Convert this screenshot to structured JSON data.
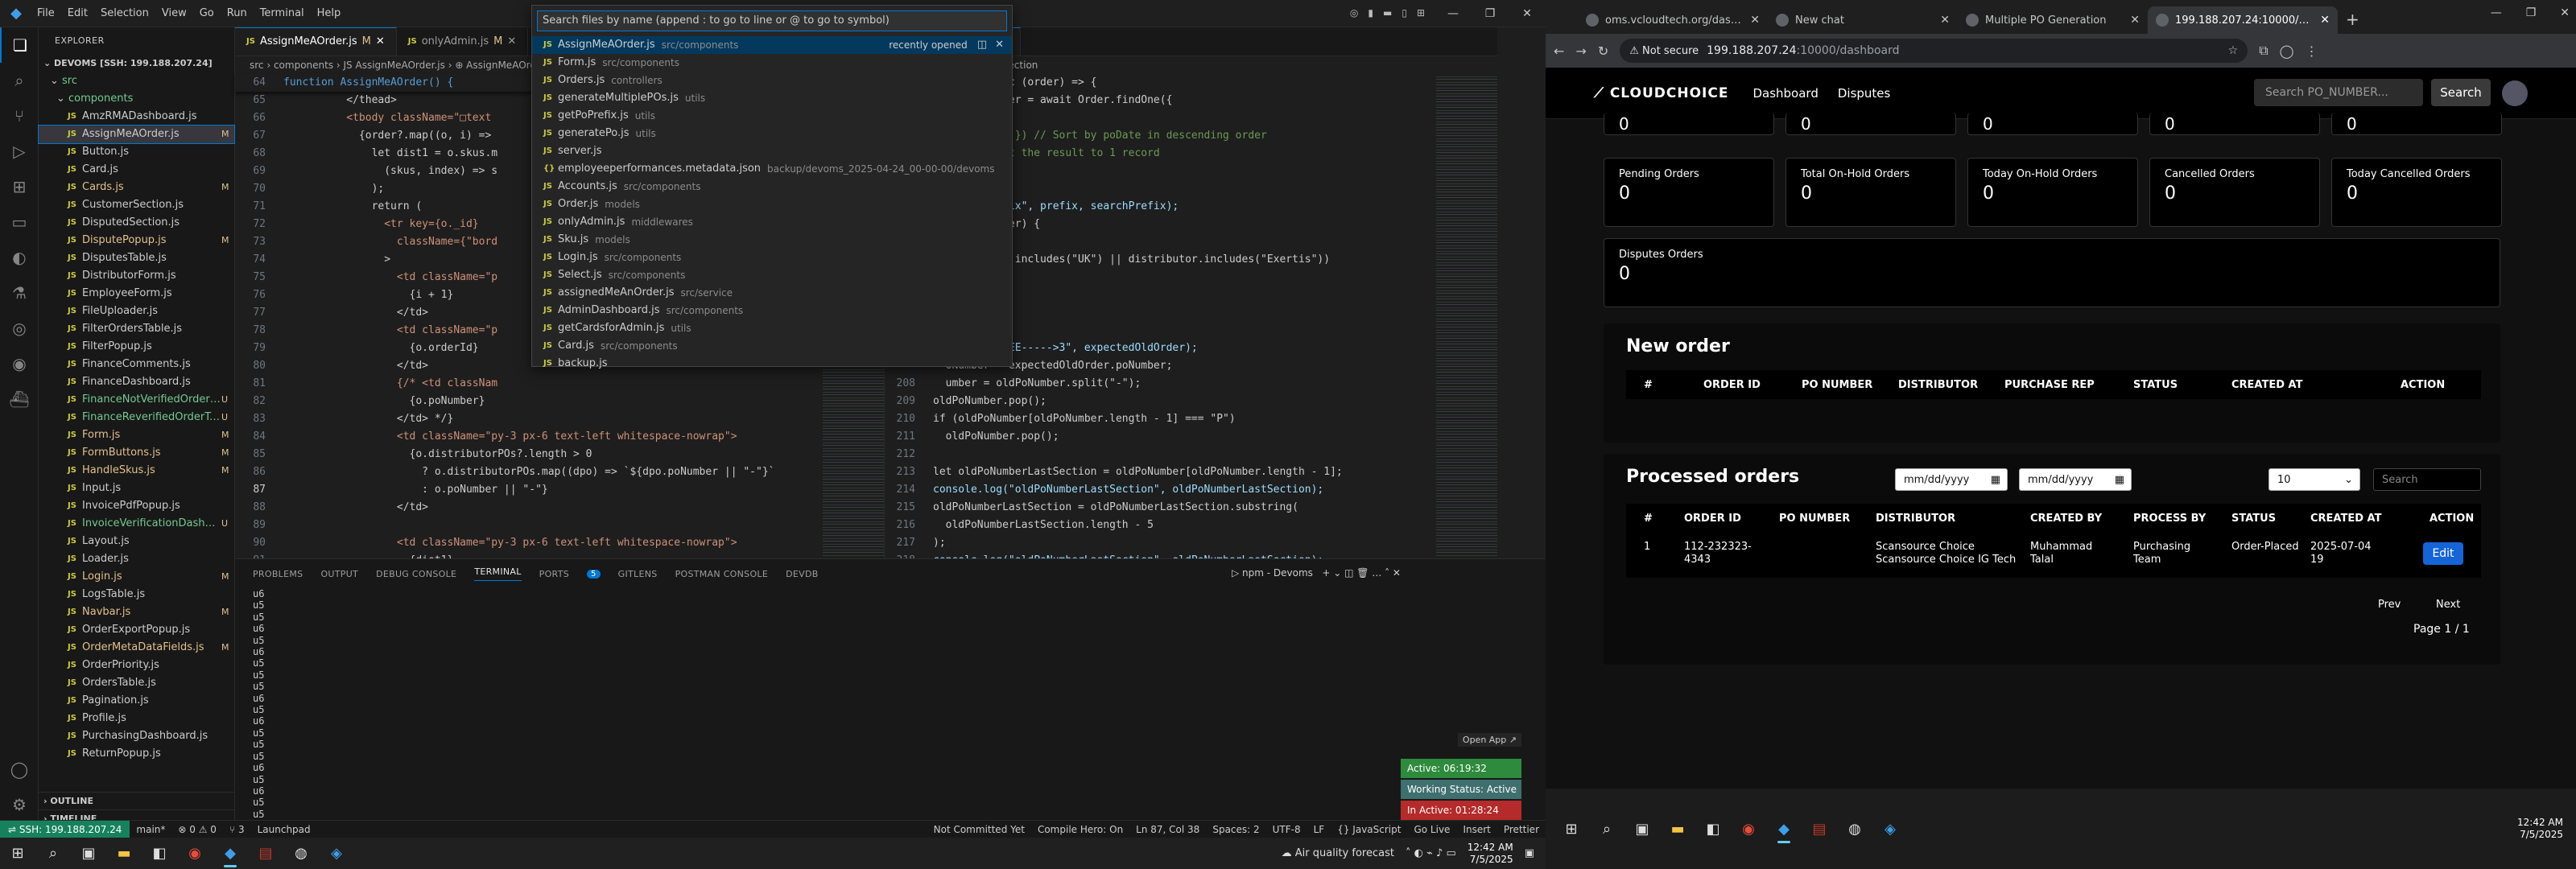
{
  "vscode": {
    "menu": [
      "File",
      "Edit",
      "Selection",
      "View",
      "Go",
      "Run",
      "Terminal",
      "Help"
    ],
    "explorer": {
      "title": "EXPLORER",
      "root": "DEVOMS [SSH: 199.188.207.24]",
      "folders": [
        "src",
        "components"
      ],
      "files": [
        {
          "name": "AmzRMADashboard.js",
          "status": ""
        },
        {
          "name": "AssignMeAOrder.js",
          "status": "M",
          "state": "sel"
        },
        {
          "name": "Button.js",
          "status": ""
        },
        {
          "name": "Card.js",
          "status": ""
        },
        {
          "name": "Cards.js",
          "status": "M",
          "state": "mod"
        },
        {
          "name": "CustomerSection.js",
          "status": ""
        },
        {
          "name": "DisputedSection.js",
          "status": ""
        },
        {
          "name": "DisputePopup.js",
          "status": "M",
          "state": "mod"
        },
        {
          "name": "DisputesTable.js",
          "status": ""
        },
        {
          "name": "DistributorForm.js",
          "status": ""
        },
        {
          "name": "EmployeeForm.js",
          "status": ""
        },
        {
          "name": "FileUploader.js",
          "status": ""
        },
        {
          "name": "FilterOrdersTable.js",
          "status": ""
        },
        {
          "name": "FilterPopup.js",
          "status": ""
        },
        {
          "name": "FinanceComments.js",
          "status": ""
        },
        {
          "name": "FinanceDashboard.js",
          "status": ""
        },
        {
          "name": "FinanceNotVerifiedOrderT...",
          "status": "U",
          "state": "untracked"
        },
        {
          "name": "FinanceReverifiedOrderTab...",
          "status": "U",
          "state": "untracked"
        },
        {
          "name": "Form.js",
          "status": "M",
          "state": "mod"
        },
        {
          "name": "FormButtons.js",
          "status": "M",
          "state": "mod"
        },
        {
          "name": "HandleSkus.js",
          "status": "M",
          "state": "mod"
        },
        {
          "name": "Input.js",
          "status": ""
        },
        {
          "name": "InvoicePdfPopup.js",
          "status": ""
        },
        {
          "name": "InvoiceVerificationDashbo...",
          "status": "U",
          "state": "untracked"
        },
        {
          "name": "Layout.js",
          "status": ""
        },
        {
          "name": "Loader.js",
          "status": ""
        },
        {
          "name": "Login.js",
          "status": "M",
          "state": "mod"
        },
        {
          "name": "LogsTable.js",
          "status": ""
        },
        {
          "name": "Navbar.js",
          "status": "M",
          "state": "mod"
        },
        {
          "name": "OrderExportPopup.js",
          "status": ""
        },
        {
          "name": "OrderMetaDataFields.js",
          "status": "M",
          "state": "mod"
        },
        {
          "name": "OrderPriority.js",
          "status": ""
        },
        {
          "name": "OrdersTable.js",
          "status": ""
        },
        {
          "name": "Pagination.js",
          "status": ""
        },
        {
          "name": "Profile.js",
          "status": ""
        },
        {
          "name": "PurchasingDashboard.js",
          "status": ""
        },
        {
          "name": "ReturnPopup.js",
          "status": ""
        }
      ],
      "outline": "OUTLINE",
      "timeline": "TIMELINE"
    },
    "editor1": {
      "tabs": [
        {
          "label": "AssignMeAOrder.js",
          "mod": "M",
          "active": true
        },
        {
          "label": "onlyAdmin.js",
          "mod": "M",
          "active": false
        }
      ],
      "breadcrumb": "src › components › JS AssignMeAOrder.js › ⊕ AssignMeAOrder",
      "sticky": "function AssignMeAOrder() {",
      "lines": [
        {
          "n": "65",
          "t": "          </thead>"
        },
        {
          "n": "66",
          "t": "          <tbody className=\"□text"
        },
        {
          "n": "67",
          "t": "            {order?.map((o, i) => "
        },
        {
          "n": "68",
          "t": "              let dist1 = o.skus.m"
        },
        {
          "n": "69",
          "t": "                (skus, index) => s"
        },
        {
          "n": "70",
          "t": "              );"
        },
        {
          "n": "71",
          "t": "              return ("
        },
        {
          "n": "72",
          "t": "                <tr key={o._id}"
        },
        {
          "n": "73",
          "t": "                  className={\"bord"
        },
        {
          "n": "74",
          "t": "                >"
        },
        {
          "n": "75",
          "t": "                  <td className=\"p"
        },
        {
          "n": "76",
          "t": "                    {i + 1}"
        },
        {
          "n": "77",
          "t": "                  </td>"
        },
        {
          "n": "78",
          "t": "                  <td className=\"p"
        },
        {
          "n": "79",
          "t": "                    {o.orderId}"
        },
        {
          "n": "80",
          "t": "                  </td>"
        },
        {
          "n": "81",
          "t": "                  {/* <td classNam"
        },
        {
          "n": "82",
          "t": "                    {o.poNumber}"
        },
        {
          "n": "83",
          "t": "                  </td> */}"
        },
        {
          "n": "84",
          "t": "                  <td className=\"py-3 px-6 text-left whitespace-nowrap\">"
        },
        {
          "n": "85",
          "t": "                    {o.distributorPOs?.length > 0"
        },
        {
          "n": "86",
          "t": "                      ? o.distributorPOs.map((dpo) => `${dpo.poNumber || \"-\"}`"
        },
        {
          "n": "87",
          "t": "                      : o.poNumber || \"-\"}"
        },
        {
          "n": "88",
          "t": "                  </td>"
        },
        {
          "n": "89",
          "t": ""
        },
        {
          "n": "90",
          "t": "                  <td className=\"py-3 px-6 text-left whitespace-nowrap\">"
        },
        {
          "n": "91",
          "t": "                    {dist1}"
        },
        {
          "n": "92",
          "t": "                  </td>"
        },
        {
          "n": "93",
          "t": "                  <td className=\"py-3 px-6 text-left whitespace-nowrap\">"
        },
        {
          "n": "94",
          "t": "                    {o.created_by.name}"
        }
      ]
    },
    "editor2": {
      "tabs": [
        {
          "label": "generatePo.js",
          "mod": "M",
          "active": true
        }
      ],
      "breadcrumb": "> nextPoNumberLastSection",
      "lines": [
        {
          "n": "",
          "t": "  ePo = async (order) => {"
        },
        {
          "n": "",
          "t": "  ctedOldOrder = await Order.findOne({"
        },
        {
          "n": "",
          "t": ""
        },
        {
          "n": "",
          "t": "  poDate: -1 }) // Sort by poDate in descending order"
        },
        {
          "n": "",
          "t": "  ); // Limit the result to 1 record"
        },
        {
          "n": "",
          "t": ""
        },
        {
          "n": "",
          "t": ""
        },
        {
          "n": "",
          "t": "  .log(\"prefix\", prefix, searchPrefix);"
        },
        {
          "n": "",
          "t": "  ctedOldOrder) {"
        },
        {
          "n": "",
          "t": "  refix +"
        },
        {
          "n": "",
          "t": "  zonAccount.includes(\"UK\") || distributor.includes(\"Exertis\"))"
        },
        {
          "n": "",
          "t": "  00001\""
        },
        {
          "n": "",
          "t": "  00001\") +"
        },
        {
          "n": "",
          "t": "  ix"
        },
        {
          "n": "",
          "t": ""
        },
        {
          "n": "",
          "t": "  .log(\"HEREEE----->3\", expectedOldOrder);"
        },
        {
          "n": "",
          "t": "  oNumber = expectedOldOrder.poNumber;"
        },
        {
          "n": "208",
          "t": "  umber = oldPoNumber.split(\"-\");"
        },
        {
          "n": "209",
          "t": "oldPoNumber.pop();"
        },
        {
          "n": "210",
          "t": "if (oldPoNumber[oldPoNumber.length - 1] === \"P\")"
        },
        {
          "n": "211",
          "t": "  oldPoNumber.pop();"
        },
        {
          "n": "212",
          "t": ""
        },
        {
          "n": "213",
          "t": "let oldPoNumberLastSection = oldPoNumber[oldPoNumber.length - 1];"
        },
        {
          "n": "214",
          "t": "console.log(\"oldPoNumberLastSection\", oldPoNumberLastSection);"
        },
        {
          "n": "215",
          "t": "oldPoNumberLastSection = oldPoNumberLastSection.substring("
        },
        {
          "n": "216",
          "t": "  oldPoNumberLastSection.length - 5"
        },
        {
          "n": "217",
          "t": ");"
        },
        {
          "n": "218",
          "t": "console.log(\"oldPoNumberLastSection\", oldPoNumberLastSection);"
        },
        {
          "n": "219",
          "t": ""
        },
        {
          "n": "220",
          "t": "oldPoNumberLastSection = Number(oldPoNumberLastSection);"
        },
        {
          "n": "221",
          "t": "console.log(\"oldPoNumberLastSection\", oldPoNumberLastSection);"
        }
      ]
    },
    "quickopen": {
      "placeholder": "Search files by name (append : to go to line or @ to go to symbol)",
      "recently_opened": "recently opened",
      "items": [
        {
          "name": "AssignMeAOrder.js",
          "path": "src/components",
          "icon": "js"
        },
        {
          "name": "Form.js",
          "path": "src/components",
          "icon": "js"
        },
        {
          "name": "Orders.js",
          "path": "controllers",
          "icon": "js"
        },
        {
          "name": "generateMultiplePOs.js",
          "path": "utils",
          "icon": "js"
        },
        {
          "name": "getPoPrefix.js",
          "path": "utils",
          "icon": "js"
        },
        {
          "name": "generatePo.js",
          "path": "utils",
          "icon": "js"
        },
        {
          "name": "server.js",
          "path": "",
          "icon": "js"
        },
        {
          "name": "employeeperformances.metadata.json",
          "path": "backup/devoms_2025-04-24_00-00-00/devoms",
          "icon": "{}"
        },
        {
          "name": "Accounts.js",
          "path": "src/components",
          "icon": "js"
        },
        {
          "name": "Order.js",
          "path": "models",
          "icon": "js"
        },
        {
          "name": "onlyAdmin.js",
          "path": "middlewares",
          "icon": "js"
        },
        {
          "name": "Sku.js",
          "path": "models",
          "icon": "js"
        },
        {
          "name": "Login.js",
          "path": "src/components",
          "icon": "js"
        },
        {
          "name": "Select.js",
          "path": "src/components",
          "icon": "js"
        },
        {
          "name": "assignedMeAnOrder.js",
          "path": "src/service",
          "icon": "js"
        },
        {
          "name": "AdminDashboard.js",
          "path": "src/components",
          "icon": "js"
        },
        {
          "name": "getCardsforAdmin.js",
          "path": "utils",
          "icon": "js"
        },
        {
          "name": "Card.js",
          "path": "src/components",
          "icon": "js"
        },
        {
          "name": "backup.js",
          "path": "",
          "icon": "js"
        }
      ]
    },
    "panel": {
      "tabs": [
        "PROBLEMS",
        "OUTPUT",
        "DEBUG CONSOLE",
        "TERMINAL",
        "PORTS",
        "GITLENS",
        "POSTMAN CONSOLE",
        "DEVDB"
      ],
      "active_tab": "TERMINAL",
      "ports_badge": "5",
      "terminal_name": "npm - Devoms",
      "terminal_lines": [
        "u6",
        "u5",
        "u5",
        "u6",
        "u5",
        "u6",
        "u5",
        "u5",
        "u5",
        "u6",
        "u5",
        "u6",
        "u5",
        "u5",
        "u5",
        "u6",
        "u5",
        "u6",
        "u5",
        "u5",
        "u6",
        "u5",
        "u5",
        "u6",
        "u5",
        "u5",
        "u5"
      ],
      "status_widgets": [
        {
          "label": "Active: 06:19:32",
          "color": "#2e8b3e"
        },
        {
          "label": "Working Status: Active",
          "color": "#3f6f6f"
        },
        {
          "label": "In Active: 01:28:24",
          "color": "#b52a2a"
        }
      ],
      "hover_link": "Open App ↗"
    },
    "statusbar": {
      "remote": "SSH: 199.188.207.24",
      "items": [
        "main*",
        "⊗ 0 ⚠ 0",
        "⑂ 3",
        "Launchpad",
        "Not Committed Yet",
        "Compile Hero: On",
        "Ln 87, Col 38",
        "Spaces: 2",
        "UTF-8",
        "LF",
        "{} JavaScript",
        "Go Live",
        "Insert",
        "Prettier"
      ]
    }
  },
  "taskbar_left": {
    "weather": "Air quality forecast",
    "time": "12:42 AM",
    "date": "7/5/2025"
  },
  "chrome": {
    "tabs": [
      {
        "label": "oms.vcloudtech.org/dashboard",
        "active": false
      },
      {
        "label": "New chat",
        "active": false
      },
      {
        "label": "Multiple PO Generation",
        "active": false
      },
      {
        "label": "199.188.207.24:10000/dashbo",
        "active": true
      }
    ],
    "url_badge": "Not secure",
    "url_host": "199.188.207.24",
    "url_path": ":10000/dashboard",
    "page": {
      "brand": "CLOUDCHOICE",
      "nav": [
        "Dashboard",
        "Disputes"
      ],
      "search_placeholder": "Search PO_NUMBER...",
      "search_button": "Search",
      "top_values": [
        "0",
        "0",
        "0",
        "0",
        "0"
      ],
      "cards": [
        {
          "label": "Pending Orders",
          "value": "0"
        },
        {
          "label": "Total On-Hold Orders",
          "value": "0"
        },
        {
          "label": "Today On-Hold Orders",
          "value": "0"
        },
        {
          "label": "Cancelled Orders",
          "value": "0"
        },
        {
          "label": "Today Cancelled Orders",
          "value": "0"
        },
        {
          "label": "Disputes Orders",
          "value": "0"
        }
      ],
      "new_order": {
        "title": "New order",
        "headers": [
          "#",
          "ORDER ID",
          "PO NUMBER",
          "DISTRIBUTOR",
          "PURCHASE REP",
          "STATUS",
          "CREATED AT",
          "ACTION"
        ]
      },
      "processed": {
        "title": "Processed orders",
        "date_placeholder": "mm/dd/yyyy",
        "page_size": "10",
        "search_placeholder": "Search",
        "headers": [
          "#",
          "ORDER ID",
          "PO NUMBER",
          "DISTRIBUTOR",
          "CREATED BY",
          "PROCESS BY",
          "STATUS",
          "CREATED AT",
          "ACTION"
        ],
        "rows": [
          {
            "n": "1",
            "order_id": "112-232323-4343",
            "po": "",
            "distributor": "Scansource Choice\nScansource Choice IG Tech",
            "created_by": "Muhammad Talal",
            "process_by": "Purchasing Team",
            "status": "Order-Placed",
            "created_at": "2025-07-04 19",
            "action": "Edit"
          }
        ],
        "prev": "Prev",
        "next": "Next",
        "page": "Page 1 / 1"
      }
    }
  },
  "taskbar_right": {
    "time": "12:42 AM",
    "date": "7/5/2025"
  }
}
